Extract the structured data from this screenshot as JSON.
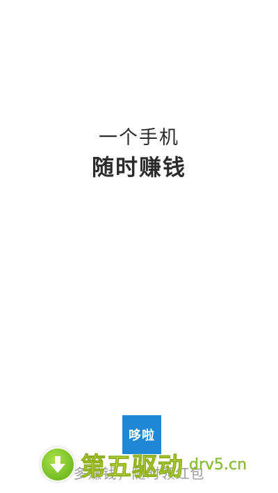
{
  "splash": {
    "slogan_line1": "一个手机",
    "slogan_line2": "随时赚钱",
    "logo_text": "哆啦",
    "tagline": "多赚钱，随时领红包"
  },
  "watermark": {
    "icon": "download-arrow-icon",
    "text": "第五驱动",
    "url": "drv5.cn"
  },
  "colors": {
    "background": "#ffffff",
    "logo_blue": "#1e88d6",
    "slogan_text": "#2b2b2b",
    "watermark_green": "#5fae14",
    "watermark_yellow": "#e8f24a"
  }
}
